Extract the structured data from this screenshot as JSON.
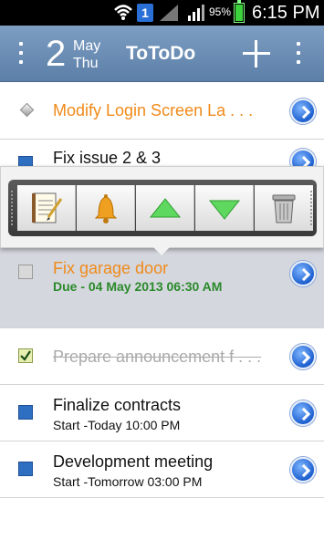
{
  "status_bar": {
    "sim_label": "1",
    "battery_percent": "95%",
    "time": "6:15 PM"
  },
  "action_bar": {
    "day_number": "2",
    "month": "May",
    "weekday": "Thu",
    "app_title": "ToToDo"
  },
  "tasks": [
    {
      "title": "Modify Login Screen La . . .",
      "subtitle": ""
    },
    {
      "title": "Fix issue 2 & 3",
      "subtitle": ""
    },
    {
      "title": "Fix garage door",
      "subtitle": "Due - 04 May 2013 06:30 AM"
    },
    {
      "title": "Prepare announcement f . . .",
      "subtitle": ""
    },
    {
      "title": "Finalize contracts",
      "subtitle": "Start -Today 10:00 PM"
    },
    {
      "title": "Development meeting",
      "subtitle": "Start -Tomorrow 03:00 PM"
    }
  ],
  "toolbar": {
    "icons": [
      "notepad-icon",
      "bell-icon",
      "move-up-icon",
      "move-down-icon",
      "trash-icon"
    ]
  },
  "colors": {
    "action_bar": "#6b8db5",
    "overdue_title": "#f08a1a",
    "due_text": "#2a8a2a",
    "selected_row": "#d4d7de"
  }
}
